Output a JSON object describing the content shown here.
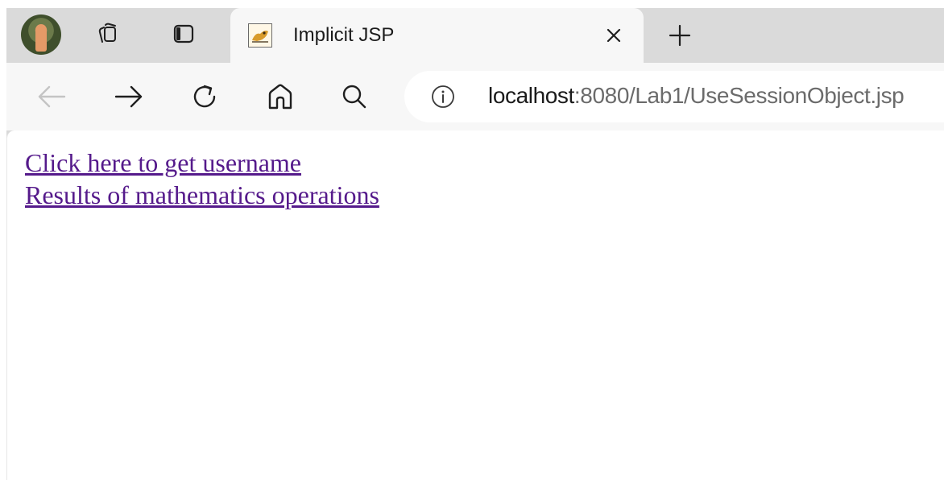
{
  "browser": {
    "tab": {
      "title": "Implicit JSP"
    },
    "address_bar": {
      "host": "localhost",
      "path": ":8080/Lab1/UseSessionObject.jsp"
    },
    "icons": {
      "profile": "profile-avatar",
      "collections": "collections-icon",
      "tab_actions": "tab-actions-icon",
      "favicon": "tomcat-favicon",
      "close_tab": "close-icon",
      "new_tab": "plus-icon",
      "back": "back-arrow-icon",
      "forward": "forward-arrow-icon",
      "refresh": "refresh-icon",
      "home": "home-icon",
      "search": "search-icon",
      "site_info": "info-icon"
    }
  },
  "page": {
    "links": [
      {
        "label": "Click here to get username"
      },
      {
        "label": "Results of mathematics operations"
      }
    ]
  },
  "colors": {
    "visited_link": "#551a8b",
    "tabstrip": "#dadada",
    "toolbar": "#f7f7f7"
  }
}
